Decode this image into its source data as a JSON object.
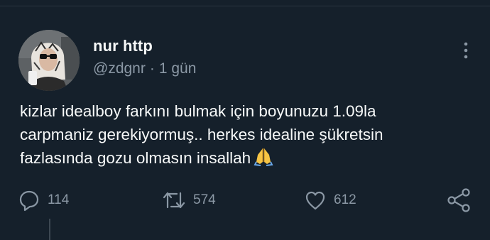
{
  "tweet": {
    "author": {
      "display_name": "nur http",
      "handle": "@zdgnr"
    },
    "separator": "·",
    "time": "1 gün",
    "text_lines": [
      "kizlar idealboy farkını bulmak için boyunuzu 1.09la",
      "carpmaniz gerekiyormuş.. herkes idealine şükretsin",
      "fazlasında gozu olmasın insallah"
    ],
    "emoji": "folded-hands",
    "stats": {
      "replies": "114",
      "retweets": "574",
      "likes": "612"
    }
  },
  "colors": {
    "background": "#15202b",
    "text": "#f7f9f9",
    "muted": "#8b98a5"
  }
}
